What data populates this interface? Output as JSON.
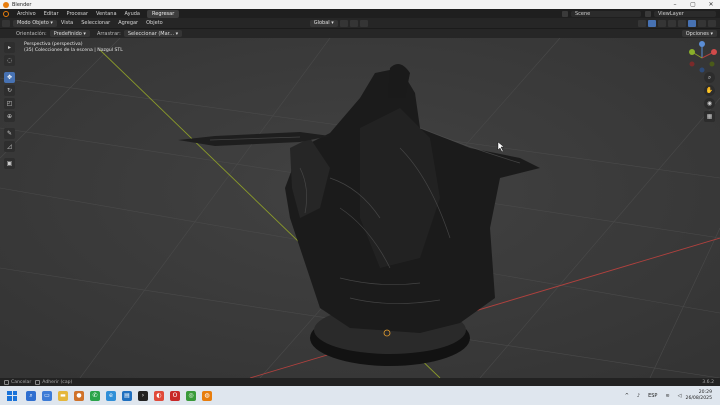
{
  "window": {
    "title": "Blender",
    "min": "–",
    "max": "▢",
    "close": "✕"
  },
  "menubar": {
    "items": [
      "Archivo",
      "Editar",
      "Procesar",
      "Ventana",
      "Ayuda"
    ],
    "workspace_tab": "Regresar",
    "scene": "Scene",
    "view_layer": "ViewLayer"
  },
  "viewport_header": {
    "mode": "Modo Objeto",
    "menus": [
      "Vista",
      "Seleccionar",
      "Agregar",
      "Objeto"
    ],
    "transform_orientation": "Global"
  },
  "tool_settings": {
    "orientation_label": "Orientación:",
    "orientation_value": "Predefinido",
    "drag_label": "Arrastrar:",
    "drag_value": "Seleccionar (Mar...",
    "options": "Opciones"
  },
  "viewport_info": {
    "line1": "Perspectiva (perspectiva)",
    "line2": "(35) Colecciones de la escena | Nazgul STL"
  },
  "statusbar": {
    "left1": "Cancelar",
    "left2": "Adherir (cap)",
    "version": "3.6.2"
  },
  "taskbar": {
    "lang": "ESP",
    "time": "20:29",
    "date": "26/08/2025"
  },
  "colors": {
    "accent": "#4772b3",
    "x_axis": "#b0413e",
    "y_axis": "#8a9a2a",
    "blender_orange": "#e87d0d"
  }
}
